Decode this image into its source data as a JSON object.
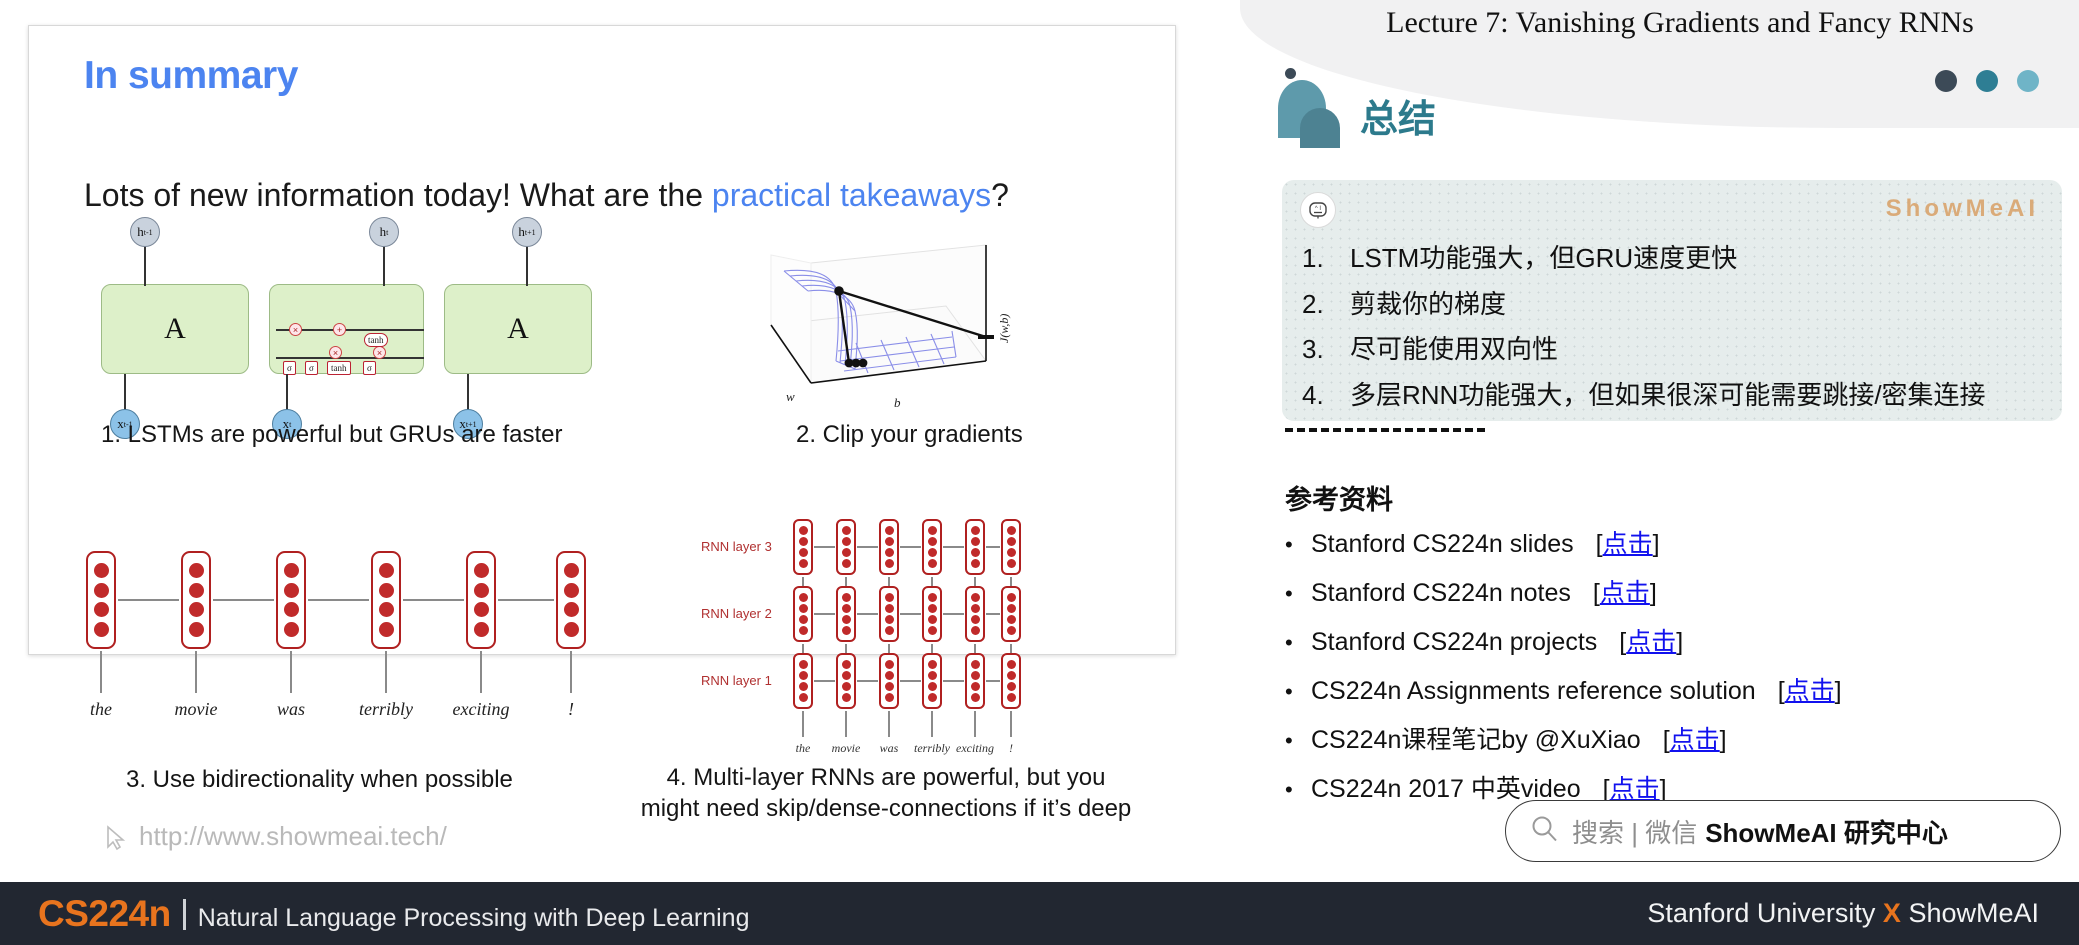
{
  "lecture": {
    "title": "Lecture 7:  Vanishing Gradients and Fancy RNNs"
  },
  "panel": {
    "heading": "总结",
    "watermark": "ShowMeAI",
    "bot_icon": "robot-icon",
    "dot_colors": [
      "#3c4a57",
      "#2e7e94",
      "#6fb4c7"
    ]
  },
  "key_points": [
    {
      "num": "1.",
      "text": "LSTM功能强大，但GRU速度更快"
    },
    {
      "num": "2.",
      "text": "剪裁你的梯度"
    },
    {
      "num": "3.",
      "text": "尽可能使用双向性"
    },
    {
      "num": "4.",
      "text": "多层RNN功能强大，但如果很深可能需要跳接/密集连接"
    }
  ],
  "references": {
    "title": "参考资料",
    "bullet": "•",
    "link_label": "点击",
    "items": [
      {
        "label": "Stanford CS224n slides"
      },
      {
        "label": "Stanford CS224n notes"
      },
      {
        "label": "Stanford CS224n projects"
      },
      {
        "label": "CS224n Assignments reference solution"
      },
      {
        "label": "CS224n课程笔记by @XuXiao"
      },
      {
        "label": "CS224n 2017 中英video"
      }
    ]
  },
  "search": {
    "icon": "search-icon",
    "gray_text": "搜索 | 微信",
    "bold_text": "ShowMeAI 研究中心"
  },
  "slide": {
    "title": "In summary",
    "lead_part1": "Lots of new information today! What are the ",
    "lead_highlight": "practical takeaways",
    "lead_part2": "?",
    "caption1": "1. LSTMs are powerful but GRUs are faster",
    "caption2": "2. Clip your gradients",
    "caption3": "3. Use bidirectionality when possible",
    "caption4_line1": "4. Multi-layer RNNs are powerful, but you",
    "caption4_line2": "might need skip/dense-connections if it’s deep",
    "watermark_url": "http://www.showmeai.tech/",
    "watermark_icon": "cursor-icon"
  },
  "lstm_diagram": {
    "cell_label": "A",
    "h_labels": [
      "h",
      "h",
      "h"
    ],
    "h_subs": [
      "t-1",
      "t",
      "t+1"
    ],
    "x_labels": [
      "x",
      "x",
      "x"
    ],
    "x_subs": [
      "t-1",
      "t",
      "t+1"
    ],
    "gates": [
      "σ",
      "σ",
      "tanh",
      "σ"
    ],
    "ops": [
      "×",
      "+",
      "×",
      "×"
    ],
    "tanh_label": "tanh"
  },
  "loss_surface": {
    "xlabel": "b",
    "ylabel": "w",
    "zlabel": "J(w,b)"
  },
  "birnn": {
    "words": [
      "the",
      "movie",
      "was",
      "terribly",
      "exciting",
      "!"
    ],
    "units_per_cell": 4
  },
  "mlrnn": {
    "layers": [
      "RNN layer 3",
      "RNN layer 2",
      "RNN layer 1"
    ],
    "words": [
      "the",
      "movie",
      "was",
      "terribly",
      "exciting",
      "!"
    ],
    "units_per_cell": 4
  },
  "footer": {
    "course": "CS224n",
    "subtitle": "Natural Language Processing with Deep Learning",
    "right_pre": "Stanford University ",
    "right_x": "X",
    "right_post": " ShowMeAI"
  },
  "colors": {
    "accent_blue": "#4C84F0",
    "teal": "#2c7a8c",
    "orange": "#E8741E",
    "footer_bg": "#222731",
    "link_blue": "#1111ee",
    "red_node": "#C02A2A"
  }
}
